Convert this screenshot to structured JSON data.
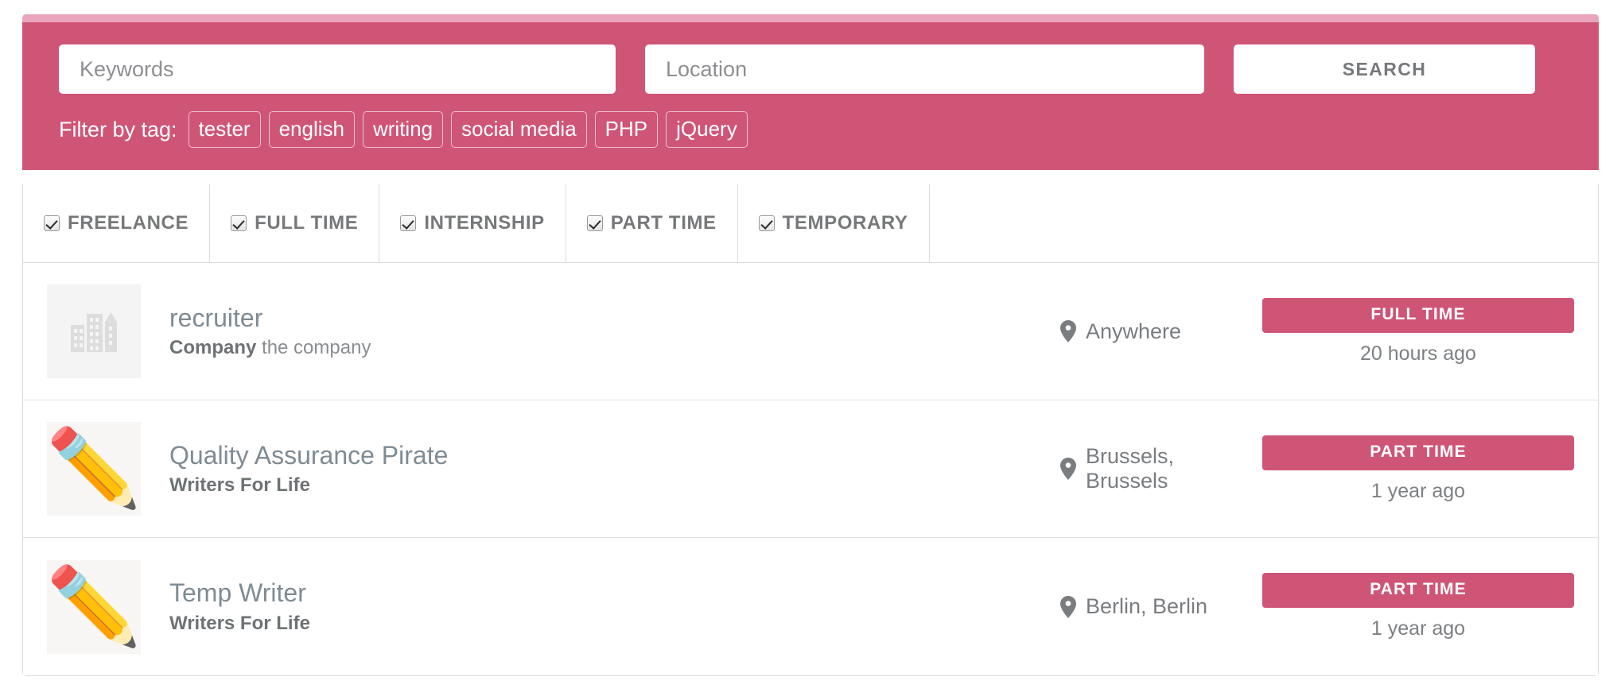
{
  "theme": {
    "brand_pink": "#cf5577",
    "brand_pink_light": "#e9a5bb",
    "text_gray": "#7a7d80",
    "border_gray": "#dcdcdc"
  },
  "search": {
    "keywords_value": "",
    "keywords_placeholder": "Keywords",
    "location_value": "",
    "location_placeholder": "Location",
    "search_button_label": "SEARCH",
    "filter_label": "Filter by tag:",
    "tags": [
      {
        "label": "tester"
      },
      {
        "label": "english"
      },
      {
        "label": "writing"
      },
      {
        "label": "social media"
      },
      {
        "label": "PHP"
      },
      {
        "label": "jQuery"
      }
    ]
  },
  "job_types": [
    {
      "label": "FREELANCE",
      "checked": true
    },
    {
      "label": "FULL TIME",
      "checked": true
    },
    {
      "label": "INTERNSHIP",
      "checked": true
    },
    {
      "label": "PART TIME",
      "checked": true
    },
    {
      "label": "TEMPORARY",
      "checked": true
    }
  ],
  "jobs": [
    {
      "logo_kind": "building-placeholder",
      "logo_glyph": "",
      "title": "recruiter",
      "company_prefix": "Company",
      "company_name": " the company",
      "location": "Anywhere",
      "badge": "FULL TIME",
      "date": "20 hours ago"
    },
    {
      "logo_kind": "emoji",
      "logo_glyph": "✏️",
      "title": "Quality Assurance Pirate",
      "company_prefix": "",
      "company_name": "Writers For Life",
      "location": "Brussels, Brussels",
      "badge": "PART TIME",
      "date": "1 year ago"
    },
    {
      "logo_kind": "emoji",
      "logo_glyph": "✏️",
      "title": "Temp Writer",
      "company_prefix": "",
      "company_name": "Writers For Life",
      "location": "Berlin, Berlin",
      "badge": "PART TIME",
      "date": "1 year ago"
    }
  ]
}
